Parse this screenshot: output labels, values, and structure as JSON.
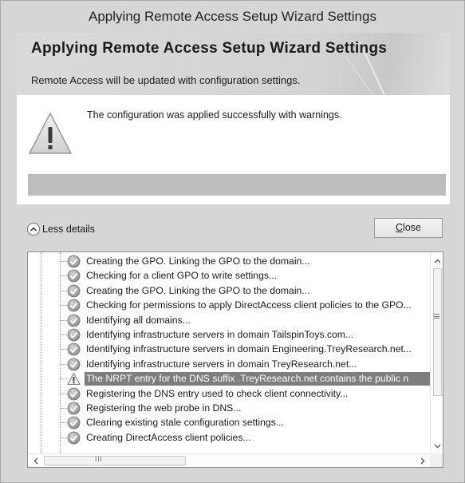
{
  "window": {
    "title": "Applying Remote Access Setup Wizard Settings"
  },
  "banner": {
    "title": "Applying Remote Access Setup Wizard Settings",
    "subtitle": "Remote Access will be updated with configuration settings."
  },
  "status": {
    "icon": "warning-icon",
    "message": "The configuration was applied successfully with warnings.",
    "progress_fraction": 1.0
  },
  "details_toggle": {
    "icon": "chevron-up-icon",
    "label": "Less details"
  },
  "close_button": {
    "mnemonic": "C",
    "rest": "lose"
  },
  "log": {
    "items": [
      {
        "icon": "success-check-icon",
        "text": "Creating the GPO. Linking the GPO to the domain...",
        "selected": false
      },
      {
        "icon": "success-check-icon",
        "text": "Checking for a client GPO to write settings...",
        "selected": false
      },
      {
        "icon": "success-check-icon",
        "text": "Creating the GPO. Linking the GPO to the domain...",
        "selected": false
      },
      {
        "icon": "success-check-icon",
        "text": "Checking for permissions to apply DirectAccess client policies to the GPO...",
        "selected": false
      },
      {
        "icon": "success-check-icon",
        "text": "Identifying all domains...",
        "selected": false
      },
      {
        "icon": "success-check-icon",
        "text": "Identifying infrastructure servers in domain TailspinToys.com...",
        "selected": false
      },
      {
        "icon": "success-check-icon",
        "text": "Identifying infrastructure servers in domain Engineering.TreyResearch.net...",
        "selected": false
      },
      {
        "icon": "success-check-icon",
        "text": "Identifying infrastructure servers in domain TreyResearch.net...",
        "selected": false
      },
      {
        "icon": "warning-icon",
        "text": "The NRPT entry for the DNS suffix .TreyResearch.net contains the public n",
        "selected": true
      },
      {
        "icon": "success-check-icon",
        "text": "Registering the DNS entry used to check client connectivity...",
        "selected": false
      },
      {
        "icon": "success-check-icon",
        "text": "Registering the web probe in DNS...",
        "selected": false
      },
      {
        "icon": "success-check-icon",
        "text": "Clearing existing stale configuration settings...",
        "selected": false
      },
      {
        "icon": "success-check-icon",
        "text": "Creating DirectAccess client policies...",
        "selected": false
      }
    ],
    "hscroll_grip": "III"
  }
}
